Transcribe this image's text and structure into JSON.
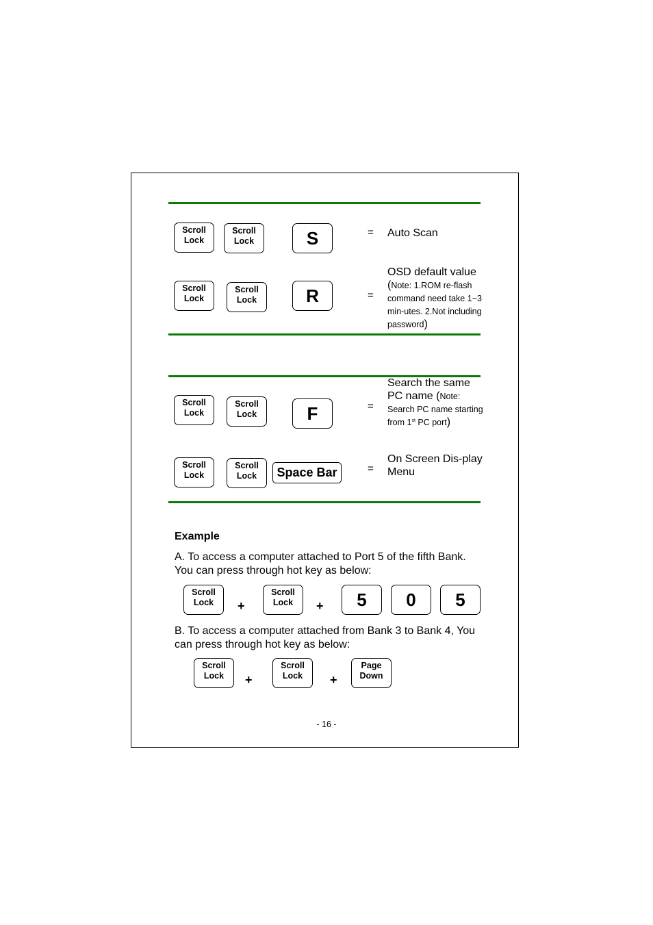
{
  "hotkeys_table_1": [
    {
      "keys": [
        "Scroll Lock",
        "Scroll Lock",
        "S"
      ],
      "equals": "=",
      "action": "Auto Scan",
      "note": ""
    },
    {
      "keys": [
        "Scroll Lock",
        "Scroll Lock",
        "R"
      ],
      "equals": "=",
      "action": "OSD default value (",
      "note": "Note: 1.ROM re-flash command need take 1~3 min-utes. 2.Not including password",
      "close": ")"
    }
  ],
  "hotkeys_table_2": [
    {
      "keys": [
        "Scroll Lock",
        "Scroll Lock",
        "F"
      ],
      "equals": "=",
      "action": "Search the same PC name (",
      "note_pre": "Note: Search PC name starting from 1",
      "note_sup": "st",
      "note_post": " PC port",
      "close": ")"
    },
    {
      "keys": [
        "Scroll Lock",
        "Scroll Lock",
        "Space Bar"
      ],
      "equals": "=",
      "action": "On Screen Dis-play Menu"
    }
  ],
  "key_labels": {
    "scroll": "Scroll",
    "lock": "Lock",
    "page": "Page",
    "down": "Down"
  },
  "example": {
    "heading": "Example",
    "a_text_1": "A. To access a computer attached to Port 5 of the fifth Bank.",
    "a_text_2": "You can press through hot key as below:",
    "a_keys": [
      "Scroll Lock",
      "+",
      "Scroll Lock",
      "+",
      "5",
      "0",
      "5"
    ],
    "b_text_1": "B. To access a computer attached from Bank 3 to Bank 4, You",
    "b_text_2": "can press through hot key as below:",
    "b_keys": [
      "Scroll Lock",
      "+",
      "Scroll Lock",
      "+",
      "Page Down"
    ]
  },
  "page_number": "- 16 -",
  "colors": {
    "rule": "#0a7a0a"
  }
}
